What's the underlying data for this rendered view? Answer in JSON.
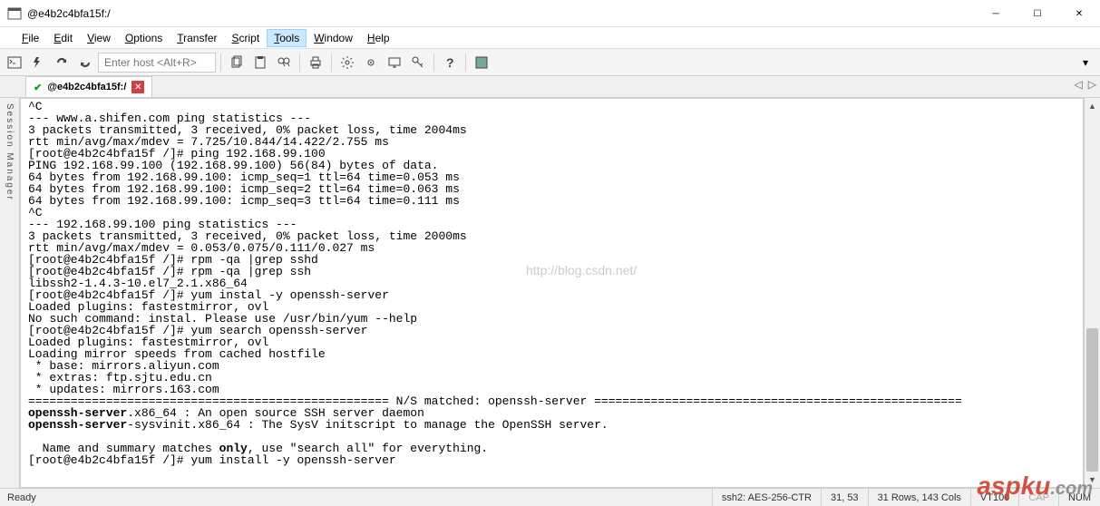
{
  "window": {
    "title": "@e4b2c4bfa15f:/",
    "min": "─",
    "max": "☐",
    "close": "✕"
  },
  "menu": {
    "items": [
      "File",
      "Edit",
      "View",
      "Options",
      "Transfer",
      "Script",
      "Tools",
      "Window",
      "Help"
    ],
    "active_index": 6
  },
  "toolbar": {
    "host_placeholder": "Enter host <Alt+R>"
  },
  "tab": {
    "title": "@e4b2c4bfa15f:/"
  },
  "sidebar": {
    "label": "Session Manager"
  },
  "terminal": {
    "lines": [
      {
        "t": "^C"
      },
      {
        "t": "--- www.a.shifen.com ping statistics ---"
      },
      {
        "t": "3 packets transmitted, 3 received, 0% packet loss, time 2004ms"
      },
      {
        "t": "rtt min/avg/max/mdev = 7.725/10.844/14.422/2.755 ms"
      },
      {
        "t": "[root@e4b2c4bfa15f /]# ping 192.168.99.100"
      },
      {
        "t": "PING 192.168.99.100 (192.168.99.100) 56(84) bytes of data."
      },
      {
        "t": "64 bytes from 192.168.99.100: icmp_seq=1 ttl=64 time=0.053 ms"
      },
      {
        "t": "64 bytes from 192.168.99.100: icmp_seq=2 ttl=64 time=0.063 ms"
      },
      {
        "t": "64 bytes from 192.168.99.100: icmp_seq=3 ttl=64 time=0.111 ms"
      },
      {
        "t": "^C"
      },
      {
        "t": "--- 192.168.99.100 ping statistics ---"
      },
      {
        "t": "3 packets transmitted, 3 received, 0% packet loss, time 2000ms"
      },
      {
        "t": "rtt min/avg/max/mdev = 0.053/0.075/0.111/0.027 ms"
      },
      {
        "t": "[root@e4b2c4bfa15f /]# rpm -qa |grep sshd"
      },
      {
        "t": "[root@e4b2c4bfa15f /]# rpm -qa |grep ssh"
      },
      {
        "t": "libssh2-1.4.3-10.el7_2.1.x86_64"
      },
      {
        "t": "[root@e4b2c4bfa15f /]# yum instal -y openssh-server"
      },
      {
        "t": "Loaded plugins: fastestmirror, ovl"
      },
      {
        "t": "No such command: instal. Please use /usr/bin/yum --help"
      },
      {
        "t": "[root@e4b2c4bfa15f /]# yum search openssh-server"
      },
      {
        "t": "Loaded plugins: fastestmirror, ovl"
      },
      {
        "t": "Loading mirror speeds from cached hostfile"
      },
      {
        "t": " * base: mirrors.aliyun.com"
      },
      {
        "t": " * extras: ftp.sjtu.edu.cn"
      },
      {
        "t": " * updates: mirrors.163.com"
      },
      {
        "t": "=================================================== N/S matched: openssh-server ===================================================="
      },
      {
        "html": "<b>openssh-server</b>.x86_64 : An open source SSH server daemon"
      },
      {
        "html": "<b>openssh-server</b>-sysvinit.x86_64 : The SysV initscript to manage the OpenSSH server."
      },
      {
        "t": ""
      },
      {
        "html": "  Name and summary matches <b>only</b>, use \"search all\" for everything."
      },
      {
        "t": "[root@e4b2c4bfa15f /]# yum install -y openssh-server"
      }
    ]
  },
  "status": {
    "ready": "Ready",
    "conn": "ssh2: AES-256-CTR",
    "pos": "31, 53",
    "size": "31 Rows, 143 Cols",
    "term": "VT100",
    "caps": "CAP",
    "num": "NUM"
  },
  "watermark": {
    "text": "aspku",
    "suffix": ".com",
    "blog": "http://blog.csdn.net/"
  }
}
